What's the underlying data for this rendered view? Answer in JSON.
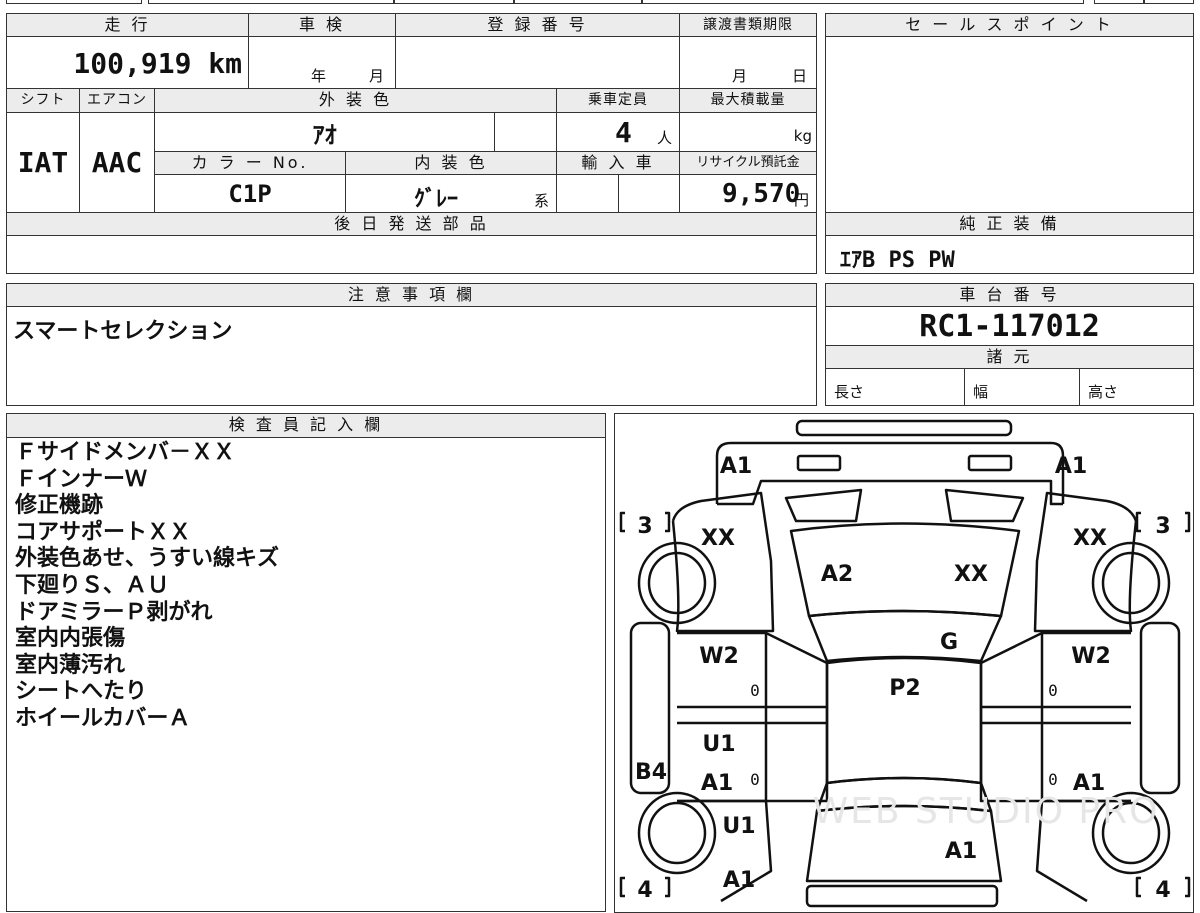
{
  "mileage": {
    "header": "走 行",
    "value": "100,919 km"
  },
  "shaken": {
    "header": "車 検",
    "year_unit": "年",
    "month_unit": "月"
  },
  "registration": {
    "header": "登 録 番 号"
  },
  "transfer_deadline": {
    "header": "譲渡書類期限",
    "month_unit": "月",
    "day_unit": "日"
  },
  "sales_point": {
    "header": "セ ー ル ス ポ イ ン ト"
  },
  "shift": {
    "header": "シフト",
    "value": "IAT"
  },
  "aircon": {
    "header": "エアコン",
    "value": "AAC"
  },
  "exterior_color": {
    "header": "外 装 色",
    "value": "ｱｵ"
  },
  "capacity": {
    "header": "乗車定員",
    "value": "4",
    "unit": "人"
  },
  "max_load": {
    "header": "最大積載量",
    "unit": "kg"
  },
  "color_no": {
    "header": "カ ラ ー No.",
    "value": "C1P"
  },
  "interior_color": {
    "header": "内 装 色",
    "value": "ｸﾞﾚｰ",
    "suffix": "系"
  },
  "import": {
    "header": "輸 入 車"
  },
  "recycle_fee": {
    "header": "リサイクル預託金",
    "value": "9,570",
    "unit": "円"
  },
  "later_parts": {
    "header": "後 日 発 送 部 品"
  },
  "genuine_equipment": {
    "header": "純 正 装 備",
    "value": "ｴｱB PS PW"
  },
  "caution": {
    "header": "注 意 事 項 欄",
    "value": "スマートセレクション"
  },
  "chassis_no": {
    "header": "車 台 番 号",
    "value": "RC1-117012"
  },
  "specs": {
    "header": "諸 元",
    "length": "長さ",
    "width": "幅",
    "height": "高さ"
  },
  "inspector": {
    "header": "検 査 員 記 入 欄",
    "lines": [
      "Ｆサイドメンバ－ＸＸ",
      "ＦインナーＷ",
      "修正機跡",
      "コアサポートＸＸ",
      "外装色あせ、うすい線キズ",
      "下廻りＳ、ＡＵ",
      "ドアミラーＰ剥がれ",
      "室内内張傷",
      "室内薄汚れ",
      "シートへたり",
      "ホイールカバーＡ"
    ]
  },
  "diagram": {
    "left_front_bumper": "A1",
    "right_front_bumper": "A1",
    "left_front_fender": "XX",
    "right_front_fender": "XX",
    "hood_left": "A2",
    "hood_right": "XX",
    "windshield": "G",
    "roof": "P2",
    "left_front_door": "W2",
    "right_front_door": "W2",
    "left_rear_door_1": "U1",
    "left_rear_door_2": "A1",
    "right_rear_door": "A1",
    "left_step": "B4",
    "left_rear_fender_1": "U1",
    "left_rear_fender_2": "A1",
    "trunk": "A1",
    "front_left_tire": "3",
    "front_right_tire": "3",
    "rear_left_tire": "4",
    "rear_right_tire": "4",
    "door_mark_left_front": "0",
    "door_mark_right_front": "0",
    "door_mark_left_rear": "0",
    "door_mark_right_rear": "0",
    "watermark": "WEB STUDIO PRO"
  }
}
